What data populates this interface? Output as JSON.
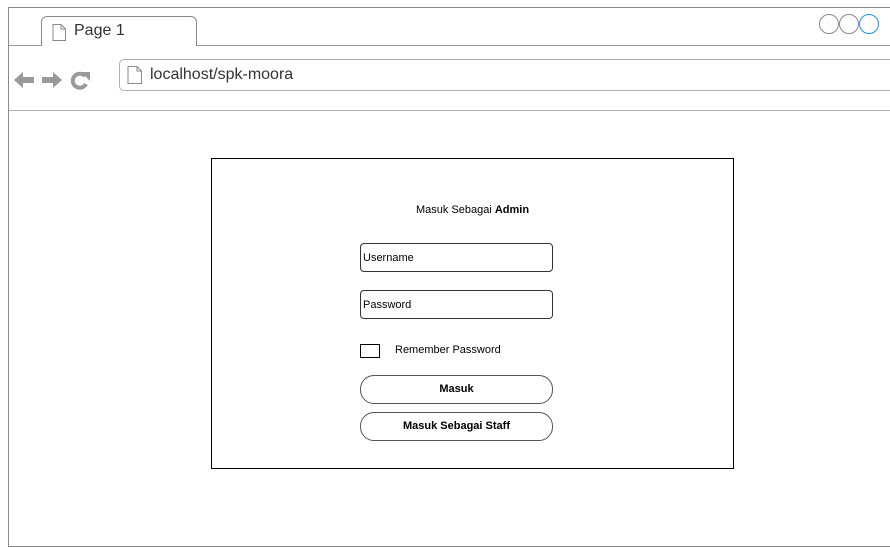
{
  "browser": {
    "tab_title": "Page 1",
    "url": "localhost/spk-moora",
    "icons": {
      "tab_page": "document-icon",
      "back": "back-arrow-icon",
      "forward": "forward-arrow-icon",
      "reload": "reload-icon",
      "address_page": "document-icon"
    },
    "colors": {
      "accent_circle": "#1e90ff",
      "chrome_border": "#8a8a8a"
    }
  },
  "login": {
    "title_prefix": "Masuk Sebagai",
    "title_role": "Admin",
    "username_placeholder": "Username",
    "password_placeholder": "Password",
    "remember_label": "Remember Password",
    "remember_checked": false,
    "submit_label": "Masuk",
    "staff_login_label": "Masuk Sebagai Staff"
  }
}
